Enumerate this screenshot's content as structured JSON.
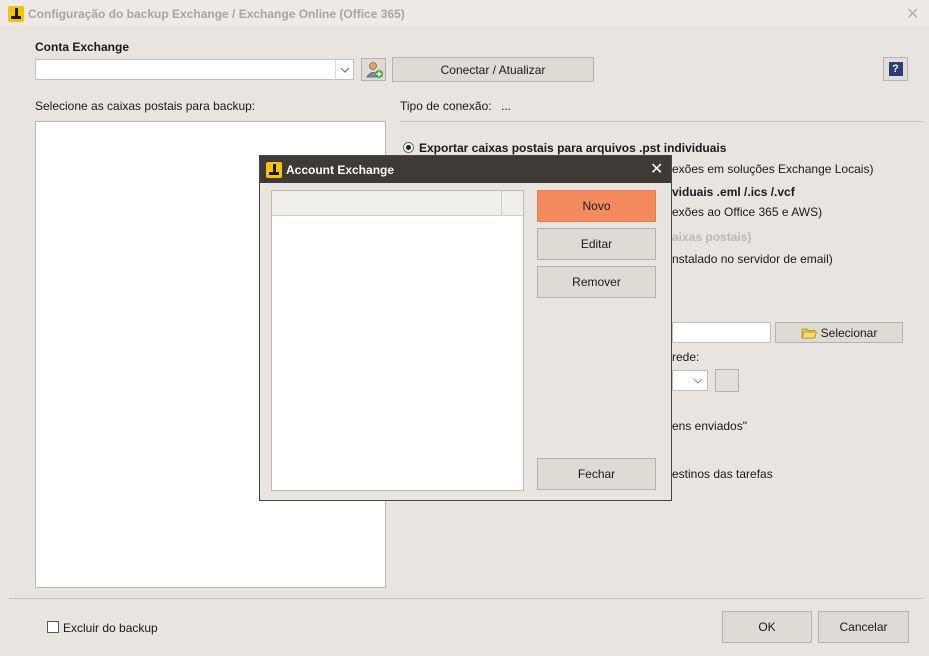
{
  "window": {
    "title": "Configuração do backup Exchange / Exchange Online (Office 365)",
    "close": "✕"
  },
  "account": {
    "section_label": "Conta Exchange",
    "select_value": "",
    "connect_button": "Conectar / Atualizar",
    "help": "?"
  },
  "mailboxes": {
    "label": "Selecione as caixas postais para backup:"
  },
  "connection": {
    "label": "Tipo de conexão:",
    "value": "..."
  },
  "options": {
    "pst_label": "Exportar caixas postais para arquivos .pst individuais",
    "pst_sub": "exões em soluções Exchange Locais)",
    "eml_label": "viduais .eml /.ics /.vcf",
    "eml_sub": "exões ao Office 365 e AWS)",
    "third_label": "aixas postais)",
    "third_sub": "nstalado no servidor de email)",
    "select_button": "Selecionar",
    "network_label": "rede:",
    "sent_label": "ens enviados\"",
    "tasks_label": "estinos das tarefas"
  },
  "footer": {
    "exclude_label": "Excluir do backup",
    "ok": "OK",
    "cancel": "Cancelar"
  },
  "dialog": {
    "title": "Account Exchange",
    "close": "✕",
    "new_button": "Novo",
    "edit_button": "Editar",
    "remove_button": "Remover",
    "close_button": "Fechar",
    "accent": "#f58a5e"
  }
}
